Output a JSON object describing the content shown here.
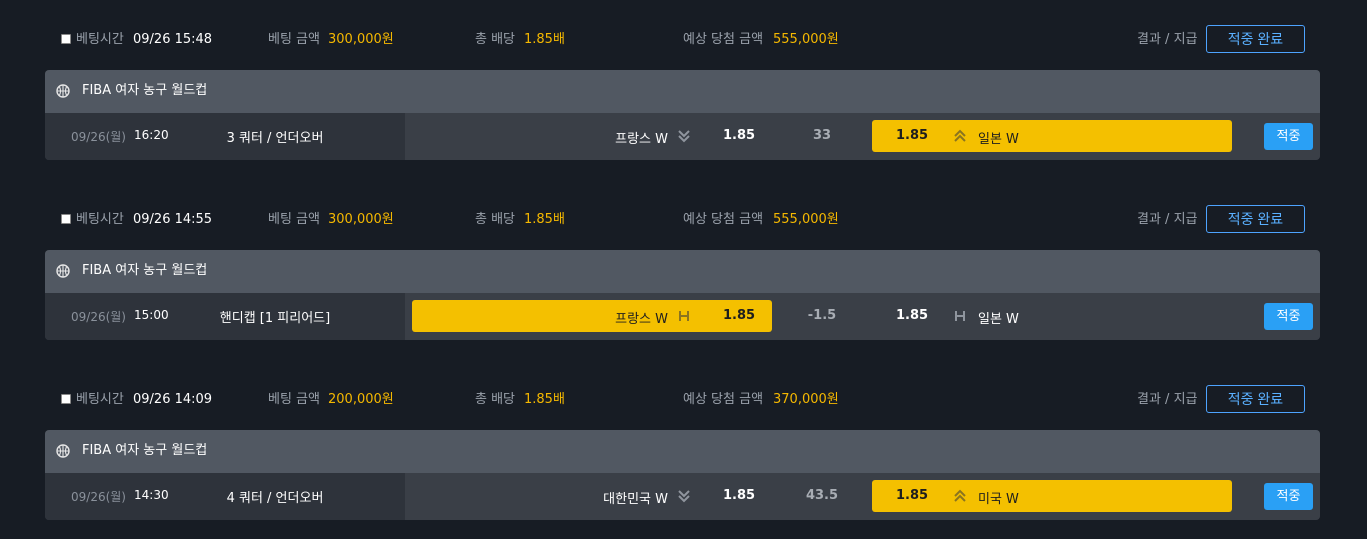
{
  "labels": {
    "bet_time": "베팅시간",
    "bet_amount": "베팅 금액",
    "total_odds": "총 배당",
    "expected_win": "예상 당첨 금액",
    "result_payout": "결과 / 지급"
  },
  "bets": [
    {
      "time": "09/26 15:48",
      "amount": "300,000원",
      "odds": "1.85배",
      "expected": "555,000원",
      "result_button": "적중 완료",
      "league": "FIBA 여자 농구 월드컵",
      "match": {
        "date": "09/26(월)",
        "time": "16:20",
        "market": "3 쿼터 / 언더오버",
        "home_team": "프랑스 W",
        "home_icon": "double-chevron-down-icon",
        "home_odds": "1.85",
        "line": "33",
        "away_odds": "1.85",
        "away_icon": "double-chevron-up-icon",
        "away_team": "일본 W",
        "selected": "away",
        "status": "적중"
      }
    },
    {
      "time": "09/26 14:55",
      "amount": "300,000원",
      "odds": "1.85배",
      "expected": "555,000원",
      "result_button": "적중 완료",
      "league": "FIBA 여자 농구 월드컵",
      "match": {
        "date": "09/26(월)",
        "time": "15:00",
        "market": "핸디캡 [1 피리어드]",
        "home_team": "프랑스 W",
        "home_icon": "handicap-h-icon",
        "home_odds": "1.85",
        "line": "-1.5",
        "away_odds": "1.85",
        "away_icon": "handicap-h-icon",
        "away_team": "일본 W",
        "selected": "home",
        "status": "적중"
      }
    },
    {
      "time": "09/26 14:09",
      "amount": "200,000원",
      "odds": "1.85배",
      "expected": "370,000원",
      "result_button": "적중 완료",
      "league": "FIBA 여자 농구 월드컵",
      "match": {
        "date": "09/26(월)",
        "time": "14:30",
        "market": "4 쿼터 / 언더오버",
        "home_team": "대한민국 W",
        "home_icon": "double-chevron-down-icon",
        "home_odds": "1.85",
        "line": "43.5",
        "away_odds": "1.85",
        "away_icon": "double-chevron-up-icon",
        "away_team": "미국 W",
        "selected": "away",
        "status": "적중"
      }
    }
  ],
  "colors": {
    "background": "#171c24",
    "gold": "#f5b800",
    "selected": "#f4c000",
    "accent_blue": "#2aa0f5",
    "outline_blue": "#4da3ff"
  }
}
